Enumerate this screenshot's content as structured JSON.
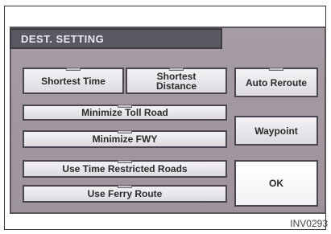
{
  "title": "DEST. SETTING",
  "buttons": {
    "shortest_time": "Shortest Time",
    "shortest_distance": "Shortest\nDistance",
    "auto_reroute": "Auto Reroute",
    "minimize_toll": "Minimize Toll Road",
    "minimize_fwy": "Minimize FWY",
    "waypoint": "Waypoint",
    "time_restricted": "Use Time Restricted Roads",
    "ok": "OK",
    "ferry": "Use Ferry Route"
  },
  "caption": "INV0293"
}
